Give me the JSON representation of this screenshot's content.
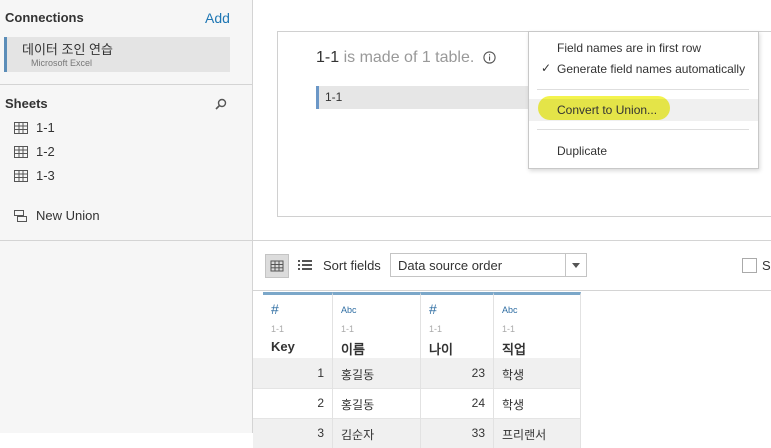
{
  "connections": {
    "title": "Connections",
    "add_label": "Add",
    "item": {
      "name": "데이터 조인 연습",
      "type": "Microsoft Excel"
    }
  },
  "sheets": {
    "title": "Sheets",
    "search_icon": "search-icon",
    "items": [
      {
        "label": "1-1",
        "icon": "table-icon"
      },
      {
        "label": "1-2",
        "icon": "table-icon"
      },
      {
        "label": "1-3",
        "icon": "table-icon"
      }
    ],
    "new_union": {
      "label": "New Union",
      "icon": "union-icon"
    }
  },
  "canvas": {
    "table_name": "1-1",
    "made_of_text": "is made of 1 table.",
    "info_icon": "info-icon",
    "table_pill": "1-1"
  },
  "context_menu": {
    "items": [
      {
        "label": "Field names are in first row",
        "checked": false
      },
      {
        "label": "Generate field names automatically",
        "checked": true
      },
      {
        "label": "Convert to Union...",
        "checked": false,
        "highlighted": true
      },
      {
        "label": "Duplicate",
        "checked": false
      }
    ],
    "check_glyph": "✓",
    "highlight_color": "#f2f23a"
  },
  "toolbar": {
    "sort_label": "Sort fields",
    "sort_value": "Data source order",
    "show_label": "S"
  },
  "grid": {
    "source": "1-1",
    "columns": [
      {
        "type": "#",
        "name": "Key",
        "align": "right"
      },
      {
        "type": "Abc",
        "name": "이름",
        "align": "left"
      },
      {
        "type": "#",
        "name": "나이",
        "align": "right"
      },
      {
        "type": "Abc",
        "name": "직업",
        "align": "left"
      }
    ],
    "rows": [
      [
        "1",
        "홍길동",
        "23",
        "학생"
      ],
      [
        "2",
        "홍길동",
        "24",
        "학생"
      ],
      [
        "3",
        "김순자",
        "33",
        "프리랜서"
      ]
    ]
  },
  "colors": {
    "accent": "#1f77b4",
    "column_header_bar": "#7ba7c9",
    "highlight": "#f2f23a"
  }
}
